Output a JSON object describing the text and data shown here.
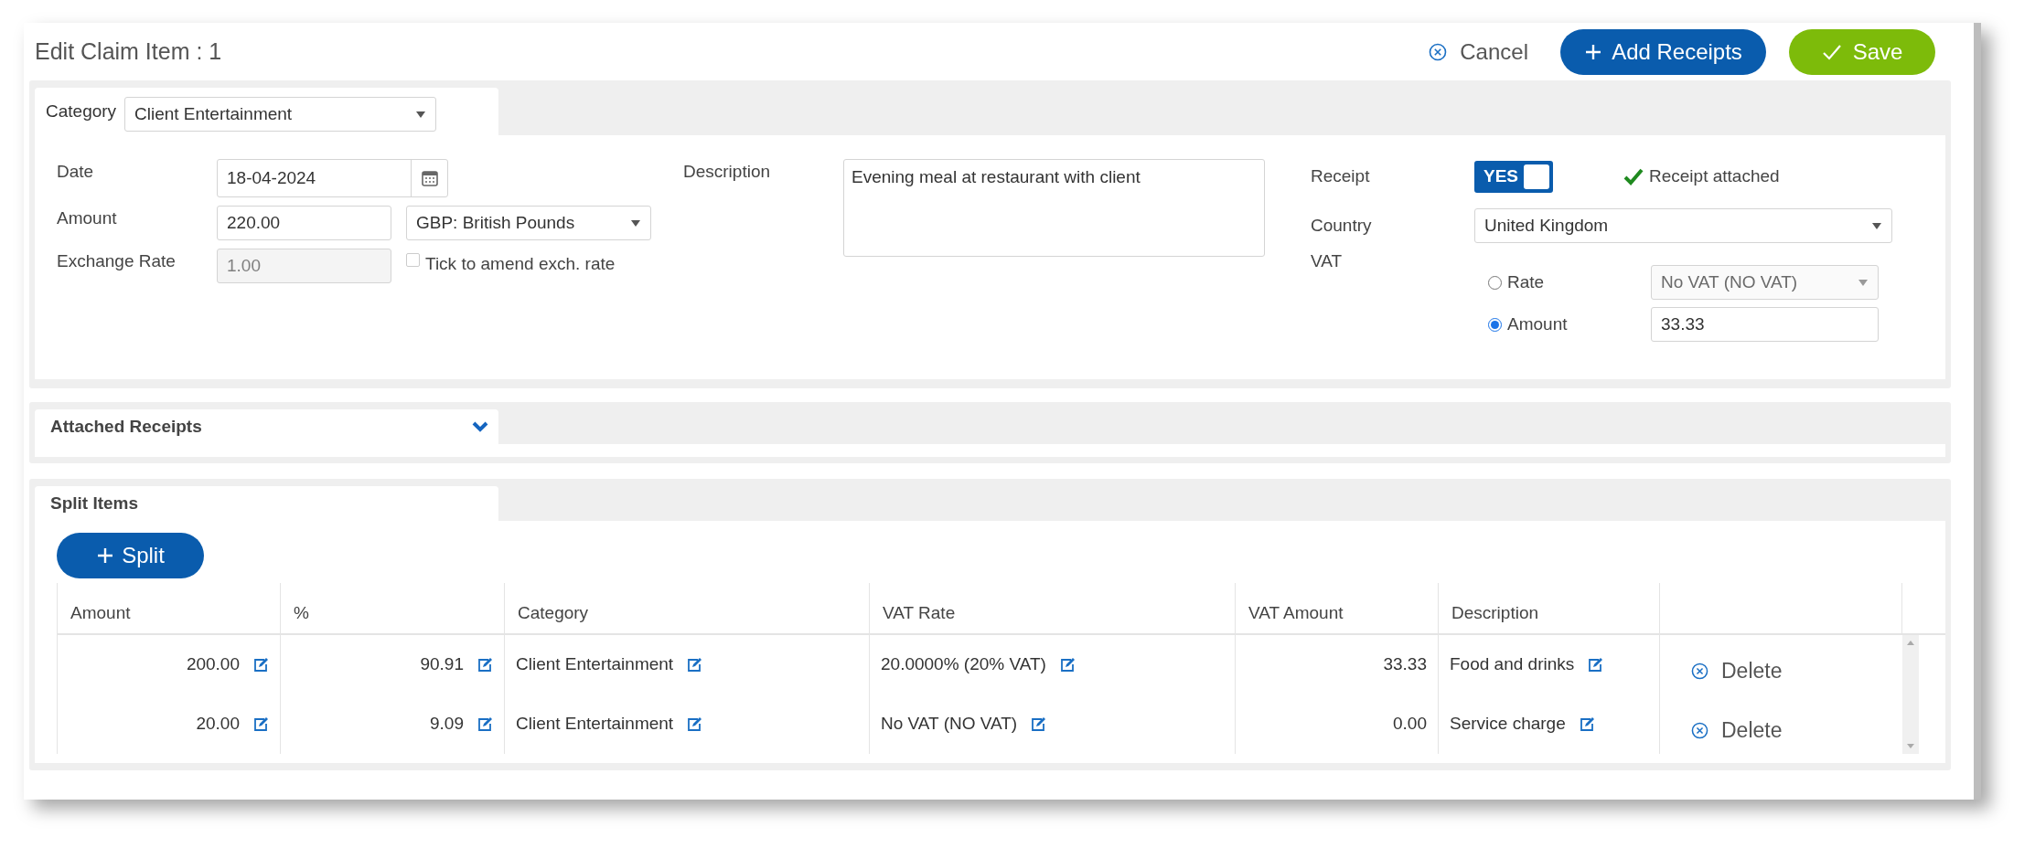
{
  "title": "Edit Claim Item : 1",
  "actions": [
    {
      "kind": "cancel",
      "label": "Cancel"
    },
    {
      "kind": "add",
      "label": "Add Receipts"
    },
    {
      "kind": "save",
      "label": "Save"
    }
  ],
  "details": {
    "tab_label": "Category",
    "category": "Client Entertainment",
    "date": {
      "label": "Date",
      "value": "18-04-2024"
    },
    "amount": {
      "label": "Amount",
      "value": "220.00",
      "currency": "GBP: British Pounds"
    },
    "exchange_rate": {
      "label": "Exchange Rate",
      "value": "1.00",
      "disabled": true,
      "amend_label": "Tick to amend exch. rate",
      "amend_checked": false
    },
    "description": {
      "label": "Description",
      "value": "Evening meal at restaurant with client"
    },
    "receipt": {
      "label": "Receipt",
      "on": true,
      "toggle_label": "YES",
      "status": "Receipt attached"
    },
    "country": {
      "label": "Country",
      "value": "United Kingdom"
    },
    "vat": {
      "label": "VAT",
      "options": [
        {
          "label": "Rate",
          "selected": false,
          "kind": "select",
          "value": "No VAT (NO VAT)"
        },
        {
          "label": "Amount",
          "selected": true,
          "kind": "input",
          "value": "33.33"
        }
      ]
    }
  },
  "attached_receipts": {
    "title": "Attached Receipts"
  },
  "split_items": {
    "title": "Split Items",
    "button": "Split",
    "columns": [
      "Amount",
      "%",
      "Category",
      "VAT Rate",
      "VAT Amount",
      "Description"
    ],
    "rows": [
      {
        "cells": [
          "200.00",
          "90.91",
          "Client Entertainment",
          "20.0000% (20% VAT)",
          "33.33",
          "Food and drinks"
        ],
        "delete": "Delete"
      },
      {
        "cells": [
          "20.00",
          "9.09",
          "Client Entertainment",
          "No VAT (NO VAT)",
          "0.00",
          "Service charge"
        ],
        "delete": "Delete"
      }
    ]
  }
}
